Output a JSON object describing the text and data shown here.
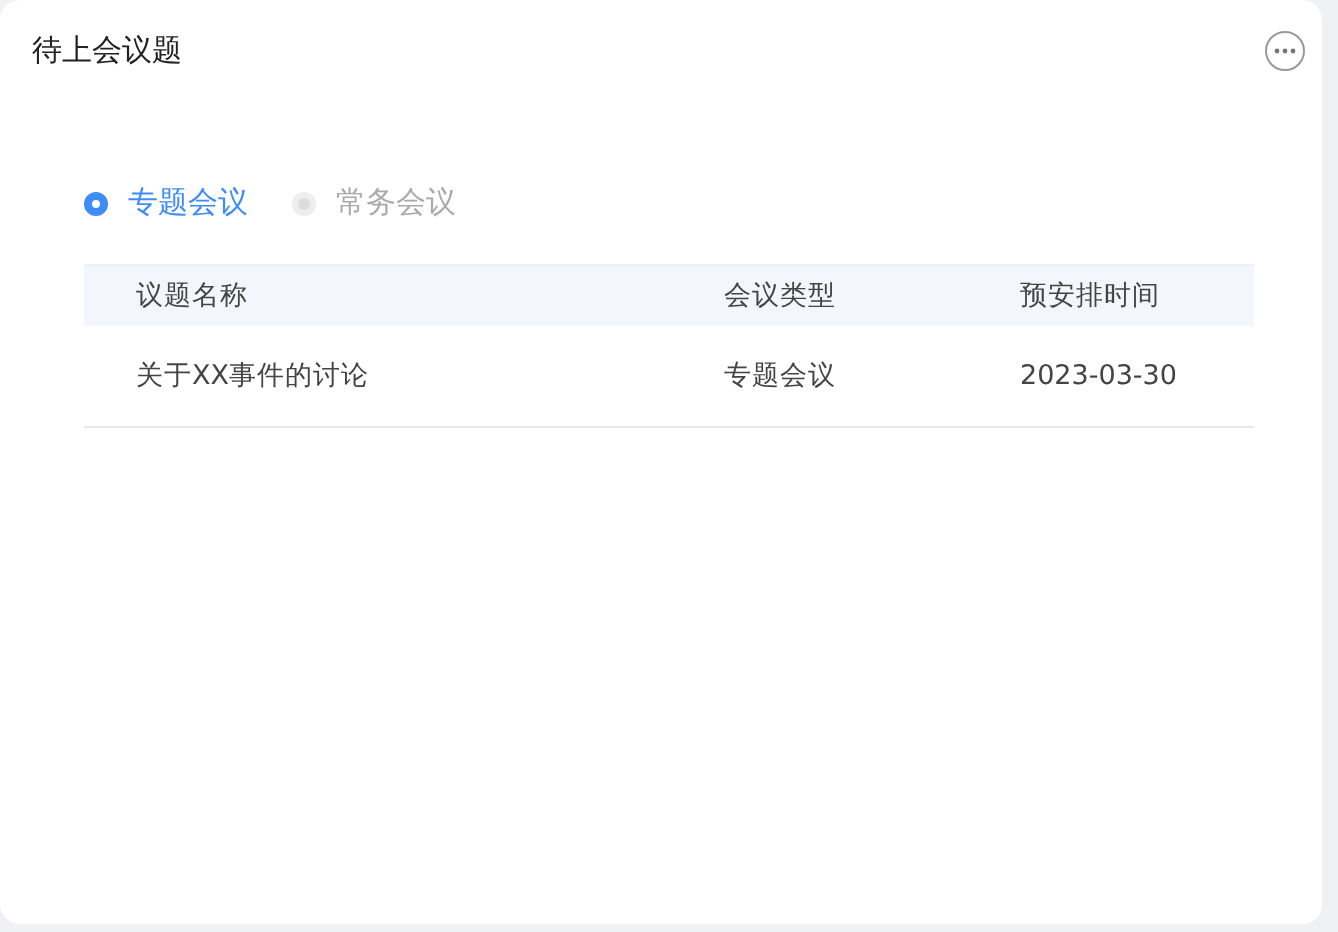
{
  "card": {
    "title": "待上会议题"
  },
  "filters": [
    {
      "label": "专题会议",
      "selected": true,
      "disabled": false
    },
    {
      "label": "常务会议",
      "selected": false,
      "disabled": true
    }
  ],
  "table": {
    "columns": [
      "议题名称",
      "会议类型",
      "预安排时间"
    ],
    "rows": [
      [
        "关于XX事件的讨论",
        "专题会议",
        "2023-03-30"
      ]
    ]
  }
}
